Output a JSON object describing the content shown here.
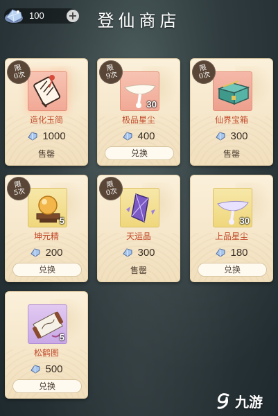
{
  "header": {
    "title": "登仙商店",
    "currency_amount": "100",
    "add_symbol": "+"
  },
  "items": [
    {
      "limit_top": "限",
      "limit_bottom": "0次",
      "name": "造化玉简",
      "price": "1000",
      "action": "售罄",
      "quantity": ""
    },
    {
      "limit_top": "限",
      "limit_bottom": "9次",
      "name": "极品星尘",
      "price": "400",
      "action": "兑换",
      "quantity": "30"
    },
    {
      "limit_top": "限",
      "limit_bottom": "0次",
      "name": "仙界宝箱",
      "price": "300",
      "action": "售罄",
      "quantity": ""
    },
    {
      "limit_top": "限",
      "limit_bottom": "5次",
      "name": "坤元精",
      "price": "200",
      "action": "兑换",
      "quantity": "5"
    },
    {
      "limit_top": "限",
      "limit_bottom": "0次",
      "name": "天运晶",
      "price": "300",
      "action": "售罄",
      "quantity": ""
    },
    {
      "limit_top": "",
      "limit_bottom": "",
      "name": "上品星尘",
      "price": "180",
      "action": "兑换",
      "quantity": "30"
    },
    {
      "limit_top": "",
      "limit_bottom": "",
      "name": "松鹤图",
      "price": "500",
      "action": "兑换",
      "quantity": "5"
    }
  ],
  "watermark": {
    "text": "九游"
  },
  "colors": {
    "item_name": "#c24a2a",
    "card_bg": "#f5e6c9",
    "limit_badge": "#5a4636"
  }
}
